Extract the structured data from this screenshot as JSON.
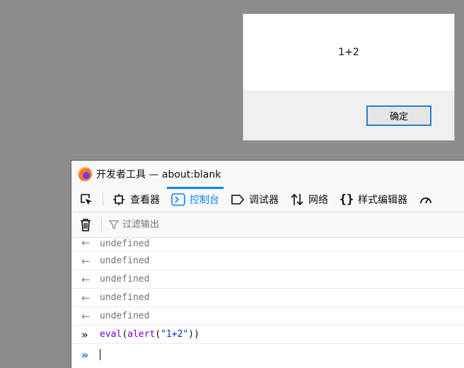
{
  "dialog": {
    "message": "1+2",
    "ok_label": "确定"
  },
  "devtools": {
    "window_title": "开发者工具 — about:blank",
    "tabs": [
      {
        "label": "查看器",
        "icon": "inspector-icon"
      },
      {
        "label": "控制台",
        "icon": "console-icon",
        "active": true
      },
      {
        "label": "调试器",
        "icon": "debugger-icon"
      },
      {
        "label": "网络",
        "icon": "network-icon"
      },
      {
        "label": "样式编辑器",
        "icon": "style-editor-icon"
      }
    ],
    "filter_placeholder": "过滤输出",
    "console_lines": [
      "undefined",
      "undefined",
      "undefined",
      "undefined",
      "undefined"
    ],
    "last_command": {
      "fn1": "eval",
      "fn2": "alert",
      "string": "\"1+2\""
    },
    "colors": {
      "accent": "#0a84ff",
      "keyword": "#8000d7",
      "string": "#002aff"
    }
  }
}
